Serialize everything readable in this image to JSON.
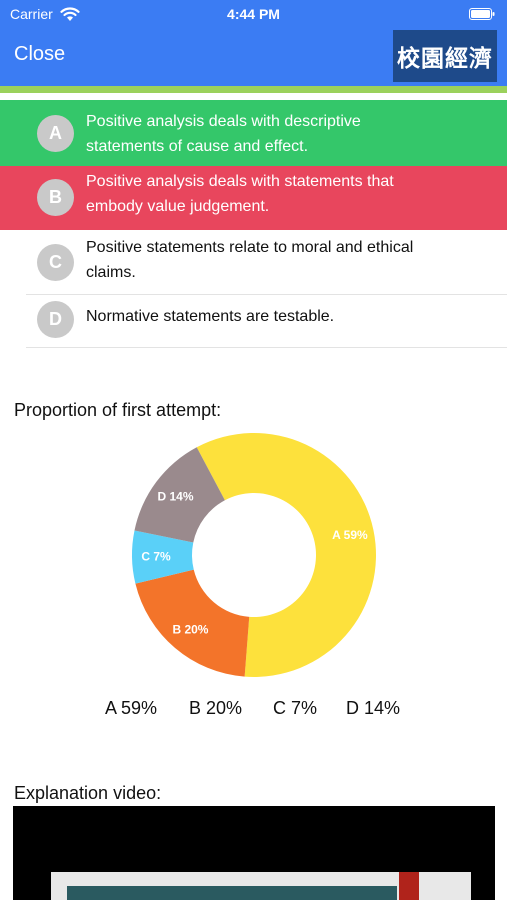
{
  "status_bar": {
    "carrier": "Carrier",
    "time": "4:44 PM"
  },
  "nav": {
    "close_label": "Close",
    "brand": "校園經濟"
  },
  "options": [
    {
      "letter": "A",
      "text": "Positive analysis deals with descriptive statements of cause and effect.",
      "state": "correct"
    },
    {
      "letter": "B",
      "text": "Positive analysis deals with statements that embody value judgement.",
      "state": "incorrect"
    },
    {
      "letter": "C",
      "text": "Positive statements relate to moral and ethical claims.",
      "state": "neutral"
    },
    {
      "letter": "D",
      "text": "Normative statements are testable.",
      "state": "neutral"
    }
  ],
  "chart_section_title": "Proportion of first attempt:",
  "chart_data": {
    "type": "pie",
    "categories": [
      "A",
      "B",
      "C",
      "D"
    ],
    "values": [
      59,
      20,
      7,
      14
    ],
    "labels": [
      "A 59%",
      "B 20%",
      "C 7%",
      "D 14%"
    ],
    "colors": [
      "#fde13c",
      "#f3742a",
      "#5ad0f8",
      "#9a8a8d"
    ]
  },
  "legend": [
    "A 59%",
    "B 20%",
    "C 7%",
    "D 14%"
  ],
  "video_section_title": "Explanation video:",
  "colors": {
    "nav": "#3b7cf3",
    "correct": "#34c76a",
    "incorrect": "#e8465d",
    "letter_badge": "#c9c9c9",
    "divider": "#9bd15c"
  }
}
